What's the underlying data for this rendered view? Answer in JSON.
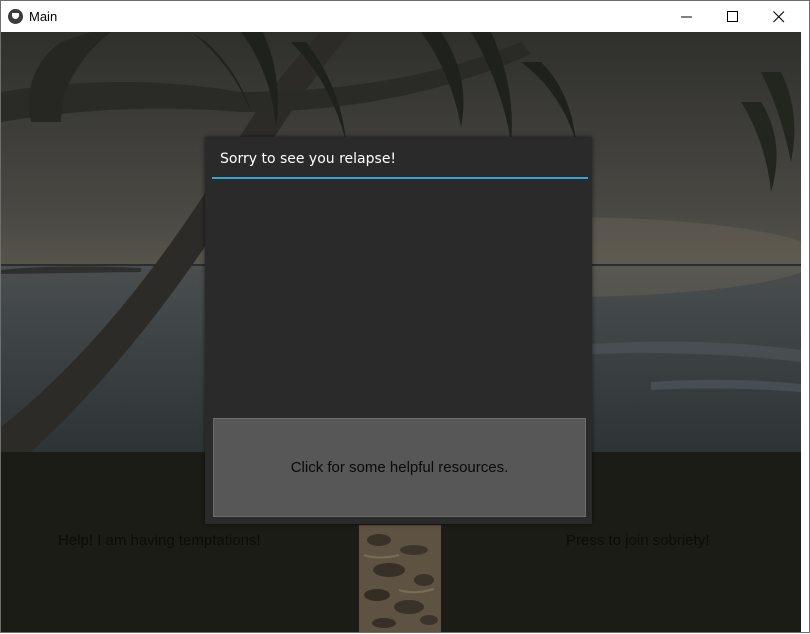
{
  "window": {
    "title": "Main",
    "icon": "kivy-app-icon",
    "controls": [
      "minimize-icon",
      "maximize-icon",
      "close-icon"
    ]
  },
  "popup": {
    "title": "Sorry to see you relapse!",
    "button_label": "Click for some helpful resources.",
    "separator_color": "#33a5d3",
    "background_color": "#2a2a2a"
  },
  "main": {
    "left_button_label": "Help! I am having temptations!",
    "right_button_label": "Press to join sobriety!",
    "background_image": "tropical beach with palm trees at sunset (dimmed)",
    "center_image": "sand with footprints"
  }
}
